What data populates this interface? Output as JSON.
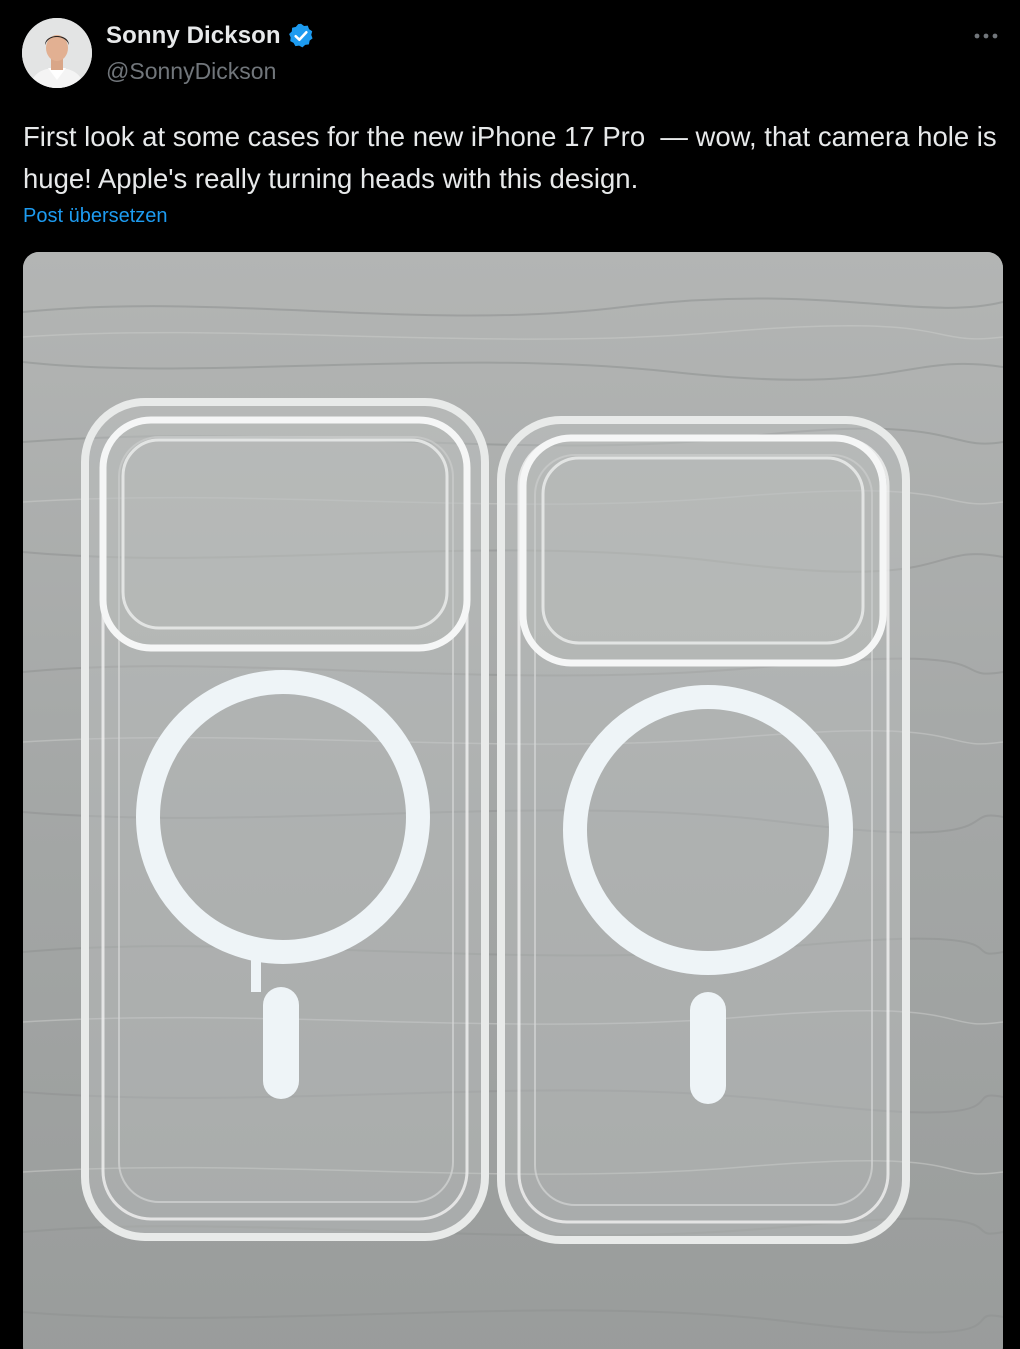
{
  "author": {
    "name": "Sonny Dickson",
    "handle": "@SonnyDickson",
    "verified": true,
    "verified_color": "#1d9bf0"
  },
  "menu": {
    "icon": "more-horizontal-icon"
  },
  "tweet": {
    "text": "First look at some cases for the new iPhone 17 Pro  — wow, that camera hole is huge! Apple's really turning heads with this design.",
    "translate_label": "Post übersetzen"
  },
  "media": {
    "type": "photo",
    "icons": [
      "phone-case-left",
      "phone-case-right"
    ]
  },
  "colors": {
    "background": "#000000",
    "text": "#e7e9ea",
    "secondary_text": "#71767b",
    "link": "#1d9bf0"
  }
}
